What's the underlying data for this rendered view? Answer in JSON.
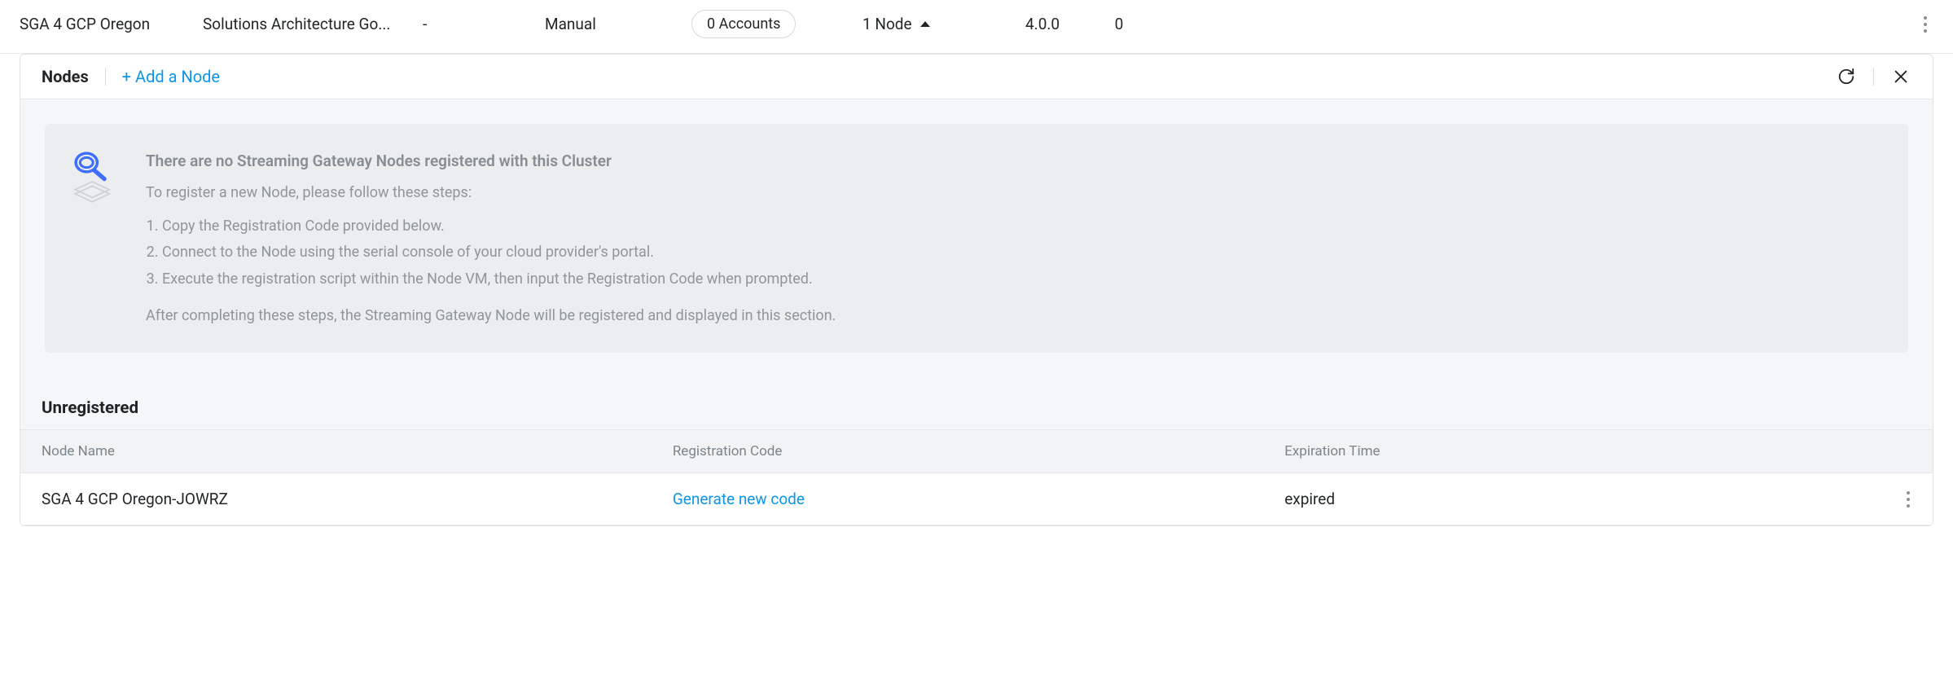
{
  "row": {
    "name": "SGA 4 GCP Oregon",
    "group": "Solutions Architecture Go...",
    "dash": "-",
    "mode": "Manual",
    "accounts": "0 Accounts",
    "nodes": "1 Node",
    "version": "4.0.0",
    "zero": "0"
  },
  "panel": {
    "title": "Nodes",
    "add_label": "+ Add a Node"
  },
  "info": {
    "heading": "There are no Streaming Gateway Nodes registered with this Cluster",
    "intro": "To register a new Node, please follow these steps:",
    "step1": "Copy the Registration Code provided below.",
    "step2": "Connect to the Node using the serial console of your cloud provider's portal.",
    "step3": "Execute the registration script within the Node VM, then input the Registration Code when prompted.",
    "outro": "After completing these steps, the Streaming Gateway Node will be registered and displayed in this section."
  },
  "unregistered": {
    "title": "Unregistered",
    "col_node": "Node Name",
    "col_code": "Registration Code",
    "col_exp": "Expiration Time",
    "node_name": "SGA 4 GCP Oregon-JOWRZ",
    "gen_link": "Generate new code",
    "expired": "expired"
  }
}
